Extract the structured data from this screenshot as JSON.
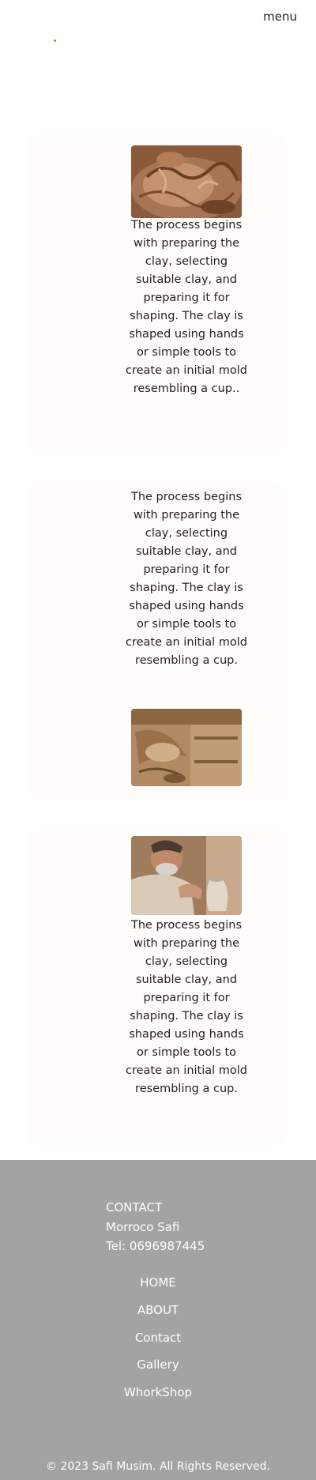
{
  "header": {
    "menu_label": "menu",
    "logo_color": "#c8752a"
  },
  "cards": [
    {
      "image_icon": "pottery-clay-hands-photo",
      "text": "The process begins with preparing the clay, selecting suitable clay, and preparing it for shaping. The clay is shaped using hands or simple tools to create an initial mold resembling a cup.."
    },
    {
      "image_icon": "pottery-clay-molding-photo",
      "text": "The process begins with preparing the clay, selecting suitable clay, and preparing it for shaping. The clay is shaped using hands or simple tools to create an initial mold resembling a cup."
    },
    {
      "image_icon": "potter-craftsman-photo",
      "text": "The process begins with preparing the clay, selecting suitable clay, and preparing it for shaping. The clay is shaped using hands or simple tools to create an initial mold resembling a cup."
    }
  ],
  "footer": {
    "contact_heading": "CONTACT",
    "location": "Morroco Safi",
    "phone": "Tel: 0696987445",
    "nav": [
      "HOME",
      "ABOUT",
      "Contact",
      "Gallery",
      "WhorkShop"
    ],
    "copyright": "© 2023 Safi Musim. All Rights Reserved.",
    "background_color": "#a3a3a3"
  }
}
